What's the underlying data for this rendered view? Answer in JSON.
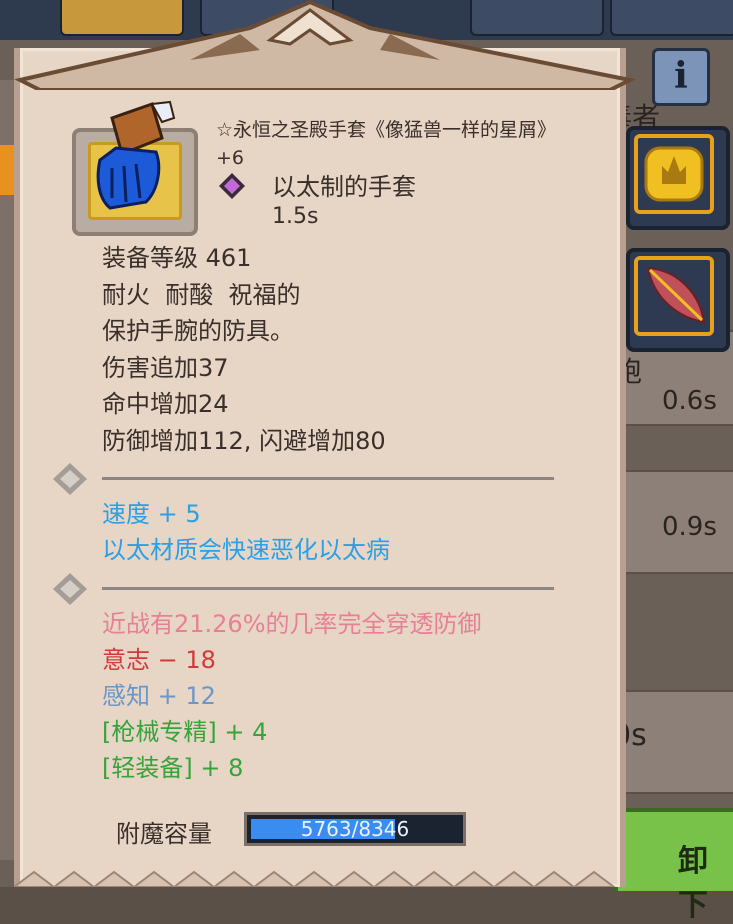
{
  "item": {
    "title": "☆永恒之圣殿手套《像猛兽一样的星屑》+6",
    "type": "以太制的手套",
    "speed": "1.5s"
  },
  "stats": [
    "装备等级 461",
    "耐火  耐酸  祝福的",
    "保护手腕的防具。",
    "伤害追加37",
    "命中增加24",
    "防御增加112, 闪避增加80"
  ],
  "blue_effects": [
    "速度 + 5",
    "以太材质会快速恶化以太病"
  ],
  "special_effects": [
    {
      "text": "近战有21.26%的几率完全穿透防御",
      "color": "#e77f95"
    },
    {
      "text": "意志 − 18",
      "color": "#d03a3a"
    },
    {
      "text": "感知 + 12",
      "color": "#6a96c8"
    },
    {
      "text": "[枪械专精] + 4",
      "color": "#36a43a"
    },
    {
      "text": "[轻装备] + 8",
      "color": "#36a43a"
    }
  ],
  "enchant": {
    "label": "附魔容量",
    "value": "5763/8346",
    "current": 5763,
    "max": 8346
  },
  "background": {
    "row_texts": [
      "毒者",
      "袍",
      "0.6s",
      "0.9s",
      "0s"
    ],
    "unequip_label": "卸下",
    "info_label": "i"
  },
  "colors": {
    "card": "#e7d6c6",
    "blue_text": "#2aa0e6",
    "slot_border": "#e7a11b"
  }
}
